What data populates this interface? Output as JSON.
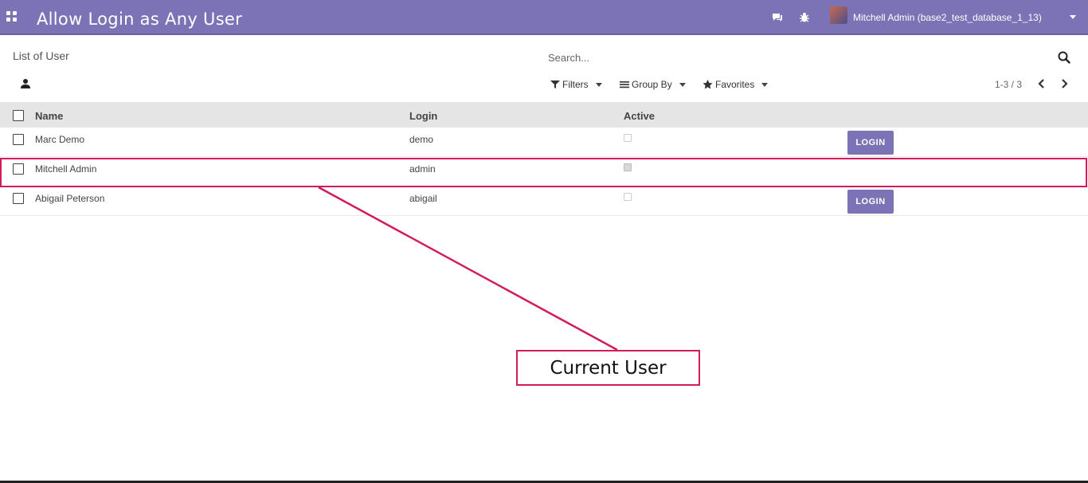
{
  "topbar": {
    "app_title": "Allow Login as Any User",
    "icons": [
      "apps-icon",
      "chat-icon",
      "bug-icon"
    ],
    "user_name": "Mitchell Admin (base2_test_database_1_13)",
    "accent_color": "#7c72b6"
  },
  "control_panel": {
    "breadcrumb": "List of User",
    "search_placeholder": "Search...",
    "filters_label": "Filters",
    "group_by_label": "Group By",
    "favorites_label": "Favorites",
    "pager": "1-3 / 3"
  },
  "list": {
    "columns": [
      "Name",
      "Login",
      "Active"
    ],
    "rows": [
      {
        "name": "Marc Demo",
        "login": "demo",
        "active": false,
        "button": "LOGIN"
      },
      {
        "name": "Mitchell Admin",
        "login": "admin",
        "active": true,
        "button": ""
      },
      {
        "name": "Abigail Peterson",
        "login": "abigail",
        "active": false,
        "button": "LOGIN"
      }
    ]
  },
  "annotation": {
    "label": "Current User",
    "color": "#d21a5e"
  }
}
